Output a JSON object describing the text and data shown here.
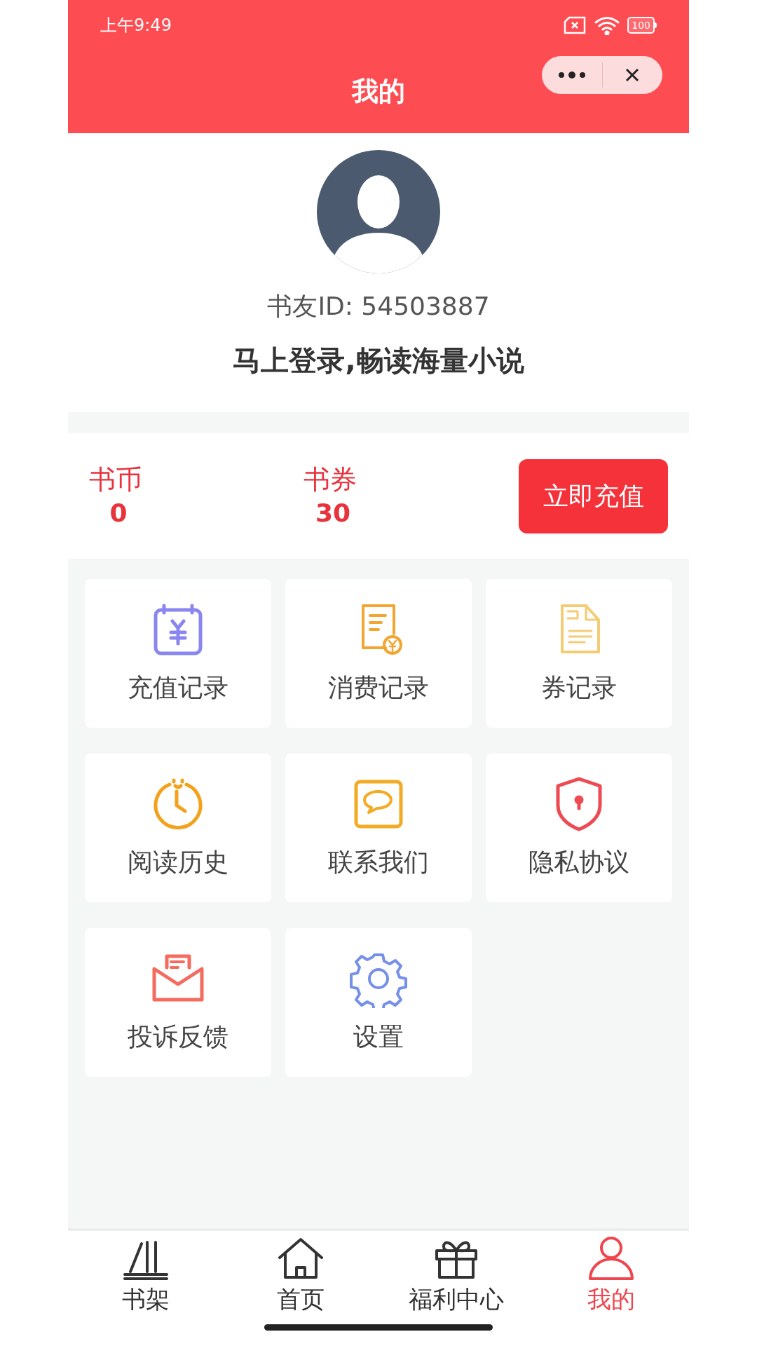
{
  "status_bar": {
    "time": "上午9:49",
    "battery": "100"
  },
  "header": {
    "title": "我的"
  },
  "profile": {
    "user_id": "书友ID: 54503887",
    "login_prompt": "马上登录,畅读海量小说"
  },
  "wallet": {
    "items": [
      {
        "label": "书币",
        "value": "0"
      },
      {
        "label": "书券",
        "value": "30"
      }
    ],
    "recharge_button": "立即充值"
  },
  "menu": [
    {
      "kind": "calendar",
      "label": "充值记录"
    },
    {
      "kind": "receipt",
      "label": "消费记录"
    },
    {
      "kind": "coupon",
      "label": "券记录"
    },
    {
      "kind": "clock",
      "label": "阅读历史"
    },
    {
      "kind": "chat",
      "label": "联系我们"
    },
    {
      "kind": "shield",
      "label": "隐私协议"
    },
    {
      "kind": "mail",
      "label": "投诉反馈"
    },
    {
      "kind": "gear",
      "label": "设置"
    }
  ],
  "tab_bar": [
    {
      "kind": "shelf",
      "label": "书架",
      "selected": false
    },
    {
      "kind": "home",
      "label": "首页",
      "selected": false
    },
    {
      "kind": "gift",
      "label": "福利中心",
      "selected": false
    },
    {
      "kind": "person",
      "label": "我的",
      "selected": true
    }
  ]
}
